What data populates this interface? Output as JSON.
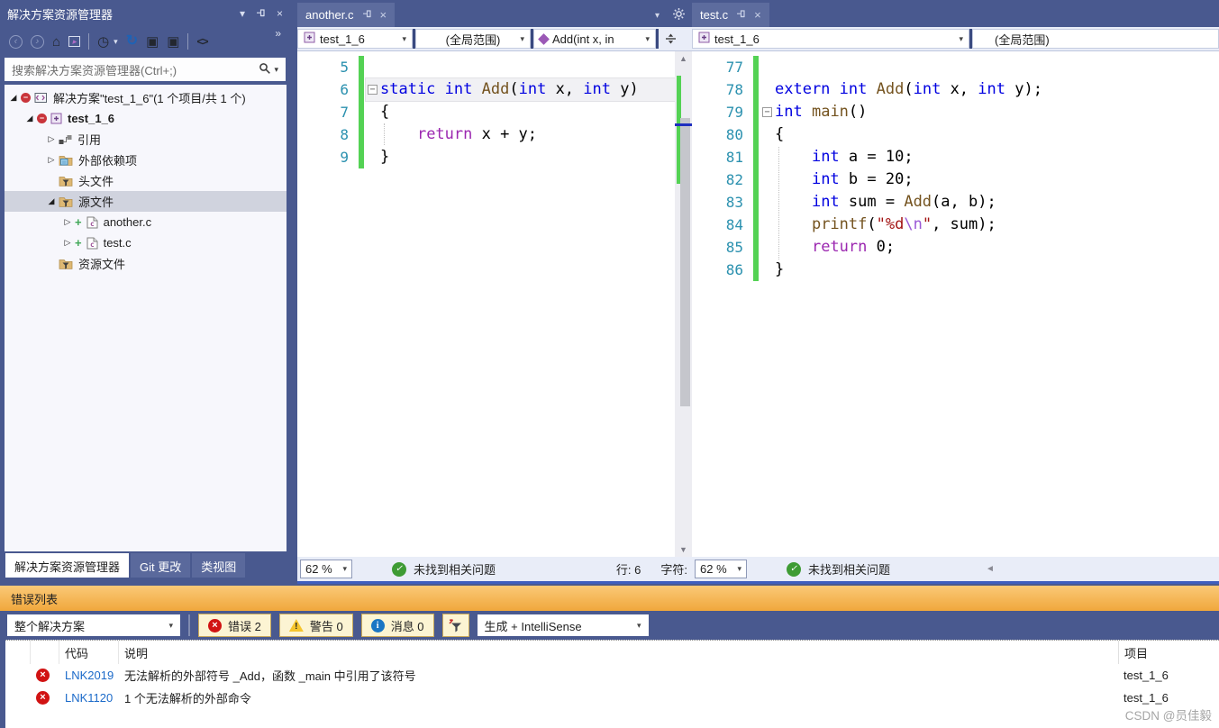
{
  "icons": {
    "back": "‹",
    "forward": "›",
    "home": "⌂",
    "sync_arrow": "▸",
    "clock": "◷",
    "dropdown": "▾",
    "refresh": "↻",
    "collapse_all": "▣",
    "properties": "▣",
    "view_code": "<>",
    "overflow": "»",
    "close": "×",
    "scroll_up": "▲",
    "scroll_down": "▼",
    "scroll_left": "◄",
    "check": "✓",
    "plus": "+",
    "fold_open": "−",
    "arrow_closed": "▷",
    "arrow_open": "◢",
    "badge_minus": "−",
    "warn_mark": "!",
    "info_mark": "i",
    "error_mark": "×"
  },
  "code_colors": {
    "k": "#0000E0",
    "c": "#9B27B0",
    "f": "#74531F",
    "s": "#A31515",
    "e": "#9B59D6",
    "p": "#000000"
  },
  "solution_explorer": {
    "title": "解决方案资源管理器",
    "search_placeholder": "搜索解决方案资源管理器(Ctrl+;)",
    "tree": [
      {
        "indent": 2,
        "arrow": "open",
        "badge": true,
        "icon": "solution-icon",
        "label": "解决方案\"test_1_6\"(1 个项目/共 1 个)"
      },
      {
        "indent": 20,
        "arrow": "open",
        "badge": true,
        "icon": "project-icon",
        "label": "test_1_6",
        "bold": true
      },
      {
        "indent": 44,
        "arrow": "closed",
        "icon": "references-icon",
        "label": "引用"
      },
      {
        "indent": 44,
        "arrow": "closed",
        "icon": "external-deps-folder-icon",
        "label": "外部依赖项"
      },
      {
        "indent": 60,
        "icon": "filter-folder-icon",
        "label": "头文件"
      },
      {
        "indent": 44,
        "arrow": "open",
        "icon": "filter-folder-icon",
        "label": "源文件",
        "selected": true
      },
      {
        "indent": 62,
        "arrow": "closed",
        "plus": true,
        "icon": "c-file-icon",
        "label": "another.c"
      },
      {
        "indent": 62,
        "arrow": "closed",
        "plus": true,
        "icon": "c-file-icon",
        "label": "test.c"
      },
      {
        "indent": 60,
        "icon": "filter-folder-icon",
        "label": "资源文件"
      }
    ],
    "bottom_tabs": [
      {
        "label": "解决方案资源管理器",
        "active": true
      },
      {
        "label": "Git 更改"
      },
      {
        "label": "类视图"
      }
    ]
  },
  "panes": [
    {
      "tab": "another.c",
      "nav": {
        "project": "test_1_6",
        "scope": "(全局范围)",
        "member": "Add(int x, in"
      },
      "status": {
        "zoom": "62 %",
        "message": "未找到相关问题",
        "line_label": "行: 6",
        "char_label": "字符:"
      },
      "lines": [
        {
          "n": 5,
          "t": []
        },
        {
          "n": 6,
          "fold": true,
          "hl": true,
          "t": [
            [
              "k",
              "static"
            ],
            [
              "p",
              " "
            ],
            [
              "k",
              "int"
            ],
            [
              "p",
              " "
            ],
            [
              "f",
              "Add"
            ],
            [
              "p",
              "("
            ],
            [
              "k",
              "int"
            ],
            [
              "p",
              " x, "
            ],
            [
              "k",
              "int"
            ],
            [
              "p",
              " y)"
            ]
          ]
        },
        {
          "n": 7,
          "t": [
            [
              "p",
              "{"
            ]
          ]
        },
        {
          "n": 8,
          "t": [
            [
              "p",
              "    "
            ],
            [
              "c",
              "return"
            ],
            [
              "p",
              " x + y;"
            ]
          ]
        },
        {
          "n": 9,
          "t": [
            [
              "p",
              "}"
            ]
          ]
        }
      ]
    },
    {
      "tab": "test.c",
      "nav": {
        "project": "test_1_6",
        "scope": "(全局范围)"
      },
      "status": {
        "zoom": "62 %",
        "message": "未找到相关问题"
      },
      "lines": [
        {
          "n": 77,
          "t": []
        },
        {
          "n": 78,
          "t": [
            [
              "k",
              "extern"
            ],
            [
              "p",
              " "
            ],
            [
              "k",
              "int"
            ],
            [
              "p",
              " "
            ],
            [
              "f",
              "Add"
            ],
            [
              "p",
              "("
            ],
            [
              "k",
              "int"
            ],
            [
              "p",
              " x, "
            ],
            [
              "k",
              "int"
            ],
            [
              "p",
              " y);"
            ]
          ]
        },
        {
          "n": 79,
          "fold": true,
          "t": [
            [
              "k",
              "int"
            ],
            [
              "p",
              " "
            ],
            [
              "f",
              "main"
            ],
            [
              "p",
              "()"
            ]
          ]
        },
        {
          "n": 80,
          "t": [
            [
              "p",
              "{"
            ]
          ]
        },
        {
          "n": 81,
          "t": [
            [
              "p",
              "    "
            ],
            [
              "k",
              "int"
            ],
            [
              "p",
              " a = 10;"
            ]
          ]
        },
        {
          "n": 82,
          "t": [
            [
              "p",
              "    "
            ],
            [
              "k",
              "int"
            ],
            [
              "p",
              " b = 20;"
            ]
          ]
        },
        {
          "n": 83,
          "t": [
            [
              "p",
              "    "
            ],
            [
              "k",
              "int"
            ],
            [
              "p",
              " sum = "
            ],
            [
              "f",
              "Add"
            ],
            [
              "p",
              "(a, b);"
            ]
          ]
        },
        {
          "n": 84,
          "t": [
            [
              "p",
              "    "
            ],
            [
              "f",
              "printf"
            ],
            [
              "p",
              "("
            ],
            [
              "s",
              "\"%d"
            ],
            [
              "e",
              "\\n"
            ],
            [
              "s",
              "\""
            ],
            [
              "p",
              ", sum);"
            ]
          ]
        },
        {
          "n": 85,
          "t": [
            [
              "p",
              "    "
            ],
            [
              "c",
              "return"
            ],
            [
              "p",
              " 0;"
            ]
          ]
        },
        {
          "n": 86,
          "t": [
            [
              "p",
              "}"
            ]
          ]
        }
      ]
    }
  ],
  "error_list": {
    "title": "错误列表",
    "scope_filter": "整个解决方案",
    "severity_buttons": [
      {
        "severity": "error",
        "label": "错误 2"
      },
      {
        "severity": "warning",
        "label": "警告 0"
      },
      {
        "severity": "info",
        "label": "消息 0"
      }
    ],
    "build_filter": "生成 + IntelliSense",
    "columns": {
      "code": "代码",
      "description": "说明",
      "project": "项目"
    },
    "rows": [
      {
        "severity": "error",
        "code": "LNK2019",
        "description": "无法解析的外部符号 _Add，函数 _main 中引用了该符号",
        "project": "test_1_6"
      },
      {
        "severity": "error",
        "code": "LNK1120",
        "description": "1 个无法解析的外部命令",
        "project": "test_1_6"
      }
    ]
  },
  "watermark": "CSDN @员佳毅"
}
